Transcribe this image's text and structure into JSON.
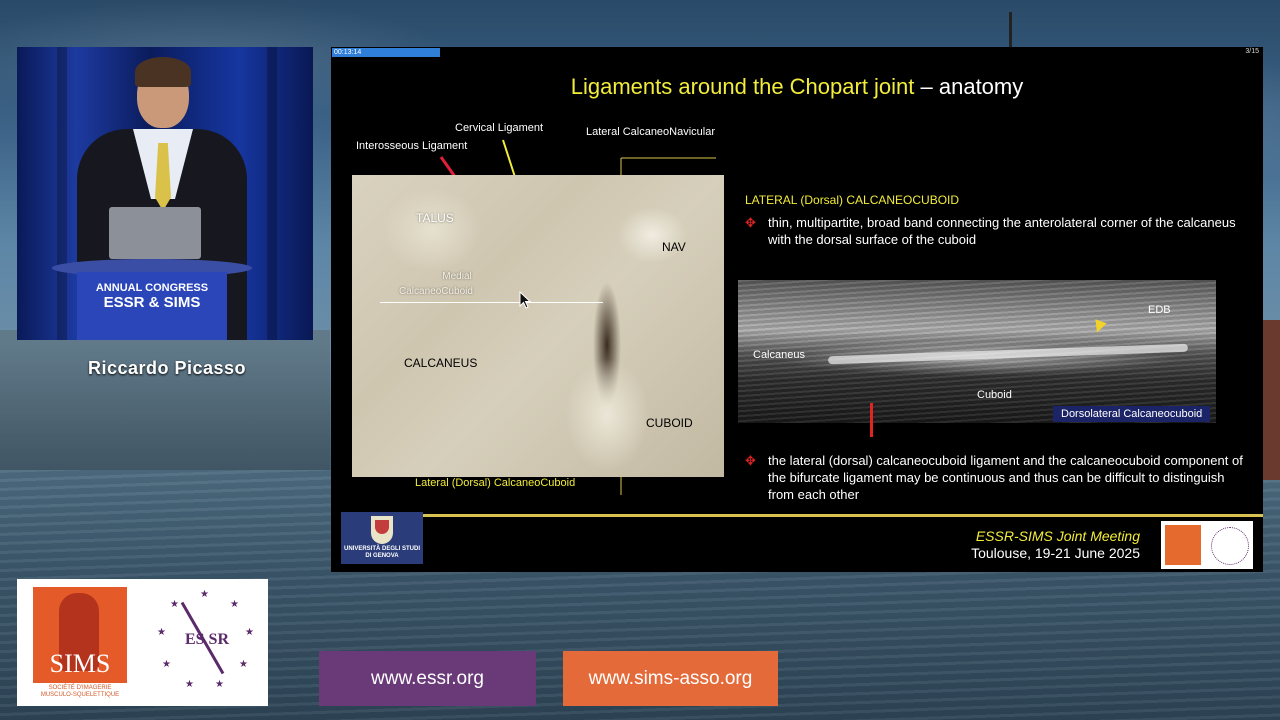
{
  "speaker": {
    "name": "Riccardo Picasso",
    "lectern_line1": "ANNUAL CONGRESS",
    "lectern_line2": "ESSR & SIMS"
  },
  "slide": {
    "timer": "00:13:14",
    "page": "3/15",
    "title_highlight": "Ligaments around the Chopart joint",
    "title_rest": " – anatomy",
    "labels": {
      "interosseous": "Interosseous Ligament",
      "cervical": "Cervical Ligament",
      "lateral_cn": "Lateral CalcaneoNavicular",
      "lateral_dorsal_cc": "Lateral (Dorsal) CalcaneoCuboid"
    },
    "photo_labels": {
      "talus": "TALUS",
      "medial_line1": "Medial",
      "medial_line2": "CalcaneoCuboid",
      "nav": "NAV",
      "calcaneus": "CALCANEUS",
      "cuboid": "CUBOID"
    },
    "section_title": "LATERAL (Dorsal) CALCANEOCUBOID",
    "bullet1_mark": "✥",
    "bullet1": "thin, multipartite, broad band connecting the anterolateral corner of the calcaneus with the dorsal surface of the cuboid",
    "ultrasound": {
      "edb": "EDB",
      "calcaneus": "Calcaneus",
      "cuboid": "Cuboid",
      "badge": "Dorsolateral Calcaneocuboid"
    },
    "bullet2_mark": "✥",
    "bullet2": "the lateral (dorsal) calcaneocuboid ligament and the calcaneocuboid component of the bifurcate ligament may be continuous and thus can be difficult to distinguish from each other",
    "university_line1": "UNIVERSITÀ DEGLI STUDI",
    "university_line2": "DI GENOVA",
    "meeting_title": "ESSR-SIMS Joint Meeting",
    "meeting_date": "Toulouse, 19-21 June 2025"
  },
  "logos": {
    "sims": "SIMS",
    "sims_sub1": "SOCIÉTÉ D'IMAGERIE",
    "sims_sub2": "MUSCULO-SQUELETTIQUE",
    "essr": "ES SR"
  },
  "links": {
    "essr": "www.essr.org",
    "sims": "www.sims-asso.org"
  },
  "colors": {
    "title_yellow": "#f2ec3a",
    "bullet_red": "#e02424",
    "essr_purple": "#6a3a78",
    "sims_orange": "#e46a3a"
  }
}
